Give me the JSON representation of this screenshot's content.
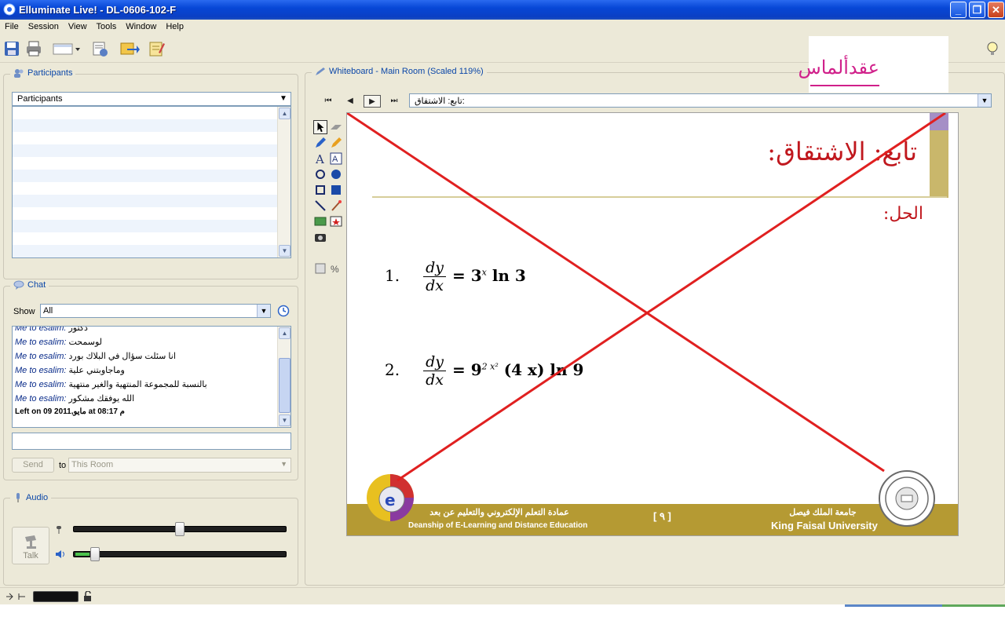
{
  "window": {
    "title": "Elluminate Live! - DL-0606-102-F"
  },
  "menu": [
    "File",
    "Session",
    "View",
    "Tools",
    "Window",
    "Help"
  ],
  "toolbar_icons": [
    "save-icon",
    "print-icon",
    "layout-icon",
    "preferences-icon",
    "transfer-icon",
    "notes-icon"
  ],
  "participants": {
    "panel_title": "Participants",
    "list_header": "Participants",
    "rows": 12
  },
  "chat": {
    "panel_title": "Chat",
    "show_label": "Show",
    "show_value": "All",
    "messages": [
      {
        "who": "Me to esalim:",
        "text": "دكتور"
      },
      {
        "who": "Me to esalim:",
        "text": "لوسمحت"
      },
      {
        "who": "Me to esalim:",
        "text": "انا سئلت سؤال في البلاك بورد"
      },
      {
        "who": "Me to esalim:",
        "text": "وماجاوبتني علية"
      },
      {
        "who": "Me to esalim:",
        "text": "بالنسبة للمجموعة المنتهية والغير منتهية"
      },
      {
        "who": "Me to esalim:",
        "text": "الله يوفقك مشكور"
      }
    ],
    "system_message": "Left on 09 مايو,2011  at 08:17 م",
    "send_label": "Send",
    "to_label": "to",
    "to_value": "This Room"
  },
  "audio": {
    "panel_title": "Audio",
    "talk_label": "Talk",
    "mic_level": 0.5,
    "speaker_level": 0.08
  },
  "whiteboard": {
    "panel_title": "Whiteboard - Main Room (Scaled 119%)",
    "page_select_value": "تابع: الاشتقاق:",
    "slide": {
      "title": "تابع: الاشتقاق:",
      "solution_label": "الحل:",
      "eq1_num": "1.",
      "eq1_frac_num": "dy",
      "eq1_frac_den": "dx",
      "eq1_rhs": "= 3",
      "eq1_sup": "x",
      "eq1_tail": " ln 3",
      "eq2_num": "2.",
      "eq2_frac_num": "dy",
      "eq2_frac_den": "dx",
      "eq2_rhs": "= 9",
      "eq2_sup": "2 x²",
      "eq2_tail": " (4 x) ln 9",
      "footer_dean_ar": "عمادة التعلم الإلكتروني والتعليم عن بعد",
      "footer_dean_en": "Deanship of E-Learning and Distance Education",
      "footer_page": "[ ٩ ]",
      "footer_univ_ar": "جامعة الملك فيصل",
      "footer_univ_en": "King Faisal University"
    }
  },
  "overlay_name": "عقدألماس",
  "colors": {
    "accent": "#0a46a8",
    "annotation_red": "#e02020",
    "slide_red": "#c0181e",
    "footer_gold": "#b59a33"
  }
}
